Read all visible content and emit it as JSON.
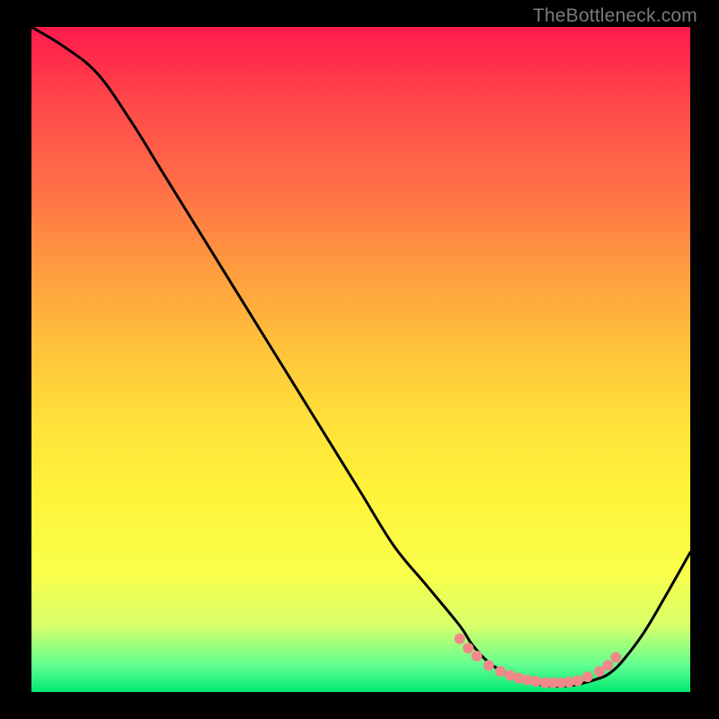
{
  "watermark": "TheBottleneck.com",
  "colors": {
    "background": "#000000",
    "curve_stroke": "#000000",
    "dot_fill": "#f08a8a",
    "gradient_stops": [
      "#ff1a4b",
      "#ff4a4a",
      "#ff6f47",
      "#ff9a3f",
      "#ffc23b",
      "#ffe23a",
      "#fff33a",
      "#f9ff4a",
      "#d8ff6a",
      "#60ff90",
      "#00e872"
    ]
  },
  "chart_data": {
    "type": "line",
    "title": "",
    "xlabel": "",
    "ylabel": "",
    "xlim": [
      0,
      100
    ],
    "ylim": [
      0,
      100
    ],
    "x": [
      0,
      5,
      10,
      15,
      20,
      25,
      30,
      35,
      40,
      45,
      50,
      55,
      60,
      65,
      67,
      70,
      74,
      78,
      82,
      86,
      88,
      90,
      93,
      96,
      100
    ],
    "y": [
      100,
      97,
      93,
      86,
      78,
      70,
      62,
      54,
      46,
      38,
      30,
      22,
      16,
      10,
      7,
      4,
      2,
      1,
      1,
      2,
      3,
      5,
      9,
      14,
      21
    ],
    "highlight_band_x": [
      65,
      89
    ],
    "dots": [
      {
        "x": 65.0,
        "y": 8.0
      },
      {
        "x": 66.3,
        "y": 6.6
      },
      {
        "x": 67.6,
        "y": 5.4
      },
      {
        "x": 69.4,
        "y": 4.0
      },
      {
        "x": 71.2,
        "y": 3.1
      },
      {
        "x": 72.7,
        "y": 2.5
      },
      {
        "x": 74.0,
        "y": 2.1
      },
      {
        "x": 75.3,
        "y": 1.8
      },
      {
        "x": 76.6,
        "y": 1.6
      },
      {
        "x": 78.0,
        "y": 1.4
      },
      {
        "x": 79.2,
        "y": 1.4
      },
      {
        "x": 80.4,
        "y": 1.4
      },
      {
        "x": 81.6,
        "y": 1.5
      },
      {
        "x": 82.9,
        "y": 1.7
      },
      {
        "x": 84.4,
        "y": 2.3
      },
      {
        "x": 86.2,
        "y": 3.1
      },
      {
        "x": 87.5,
        "y": 4.0
      },
      {
        "x": 88.7,
        "y": 5.2
      }
    ]
  }
}
